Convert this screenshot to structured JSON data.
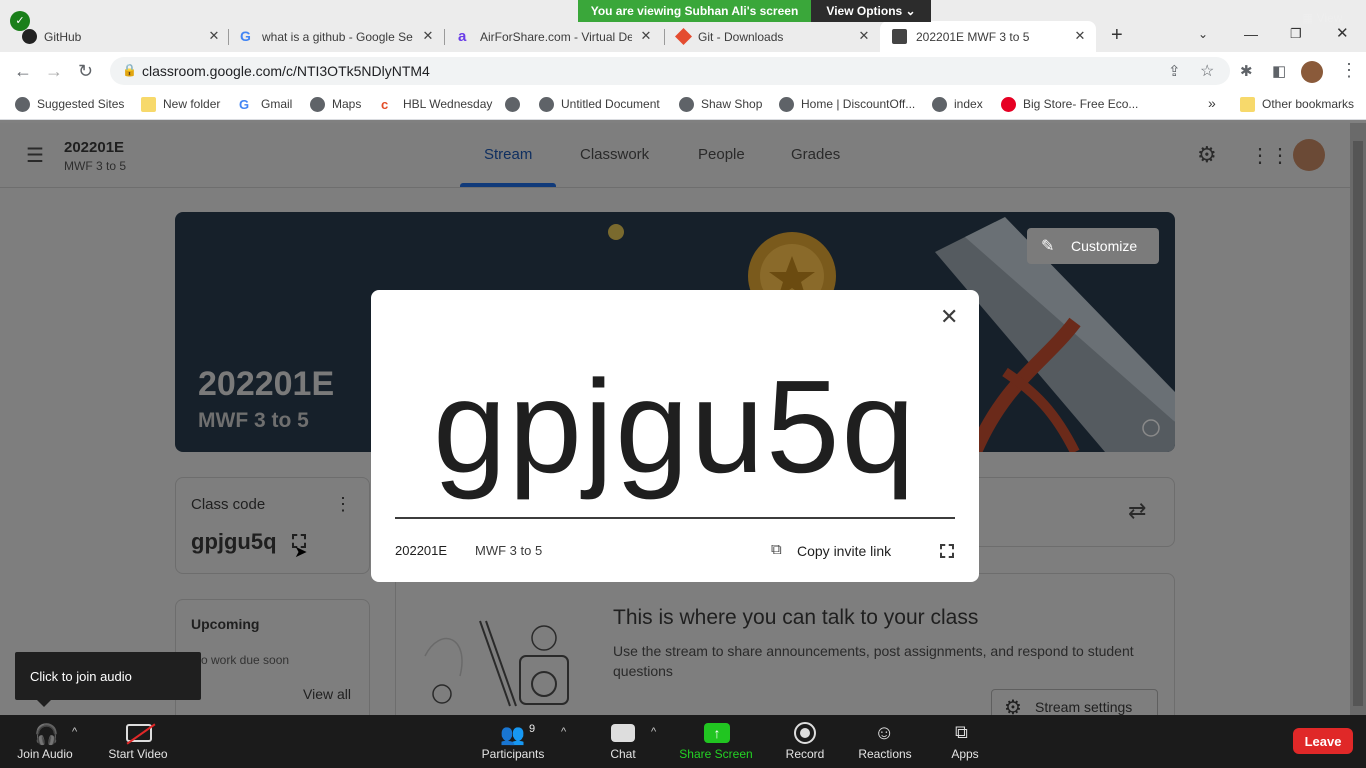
{
  "zoom_overlay": {
    "share_banner": "You are viewing Subhan Ali's screen",
    "view_options": "View Options",
    "view_label": "View"
  },
  "tabs": [
    {
      "title": "GitHub"
    },
    {
      "title": "what is a github - Google Se"
    },
    {
      "title": "AirForShare.com - Virtual De"
    },
    {
      "title": "Git - Downloads"
    },
    {
      "title": "202201E MWF 3 to 5"
    }
  ],
  "address": {
    "url": "classroom.google.com/c/NTI3OTk5NDlyNTM4"
  },
  "bookmarks": [
    "Suggested Sites",
    "New folder",
    "Gmail",
    "Maps",
    "HBL Wednesday",
    "",
    "Untitled Document",
    "Shaw Shop",
    "Home | DiscountOff...",
    "index",
    "Big Store- Free Eco...",
    "Other bookmarks"
  ],
  "classroom": {
    "class_name": "202201E",
    "section": "MWF 3 to 5",
    "nav_tabs": [
      "Stream",
      "Classwork",
      "People",
      "Grades"
    ],
    "customize_label": "Customize",
    "banner_title": "202201E",
    "banner_subtitle": "MWF 3 to 5",
    "class_code_label": "Class code",
    "class_code": "gpjgu5q",
    "upcoming_title": "Upcoming",
    "upcoming_text": "o work due soon",
    "view_all": "View all",
    "stream_heading": "This is where you can talk to your class",
    "stream_body": "Use the stream to share announcements, post assignments, and respond to student questions",
    "stream_settings": "Stream settings"
  },
  "modal": {
    "code": "gpjgu5q",
    "class_name": "202201E",
    "section": "MWF 3 to 5",
    "copy_invite_link": "Copy invite link"
  },
  "zoom_toolbar": {
    "join_audio": "Join Audio",
    "start_video": "Start Video",
    "participants": "Participants",
    "participant_count": "9",
    "chat": "Chat",
    "share_screen": "Share Screen",
    "record": "Record",
    "reactions": "Reactions",
    "apps": "Apps",
    "leave": "Leave",
    "tooltip": "Click to join audio"
  }
}
